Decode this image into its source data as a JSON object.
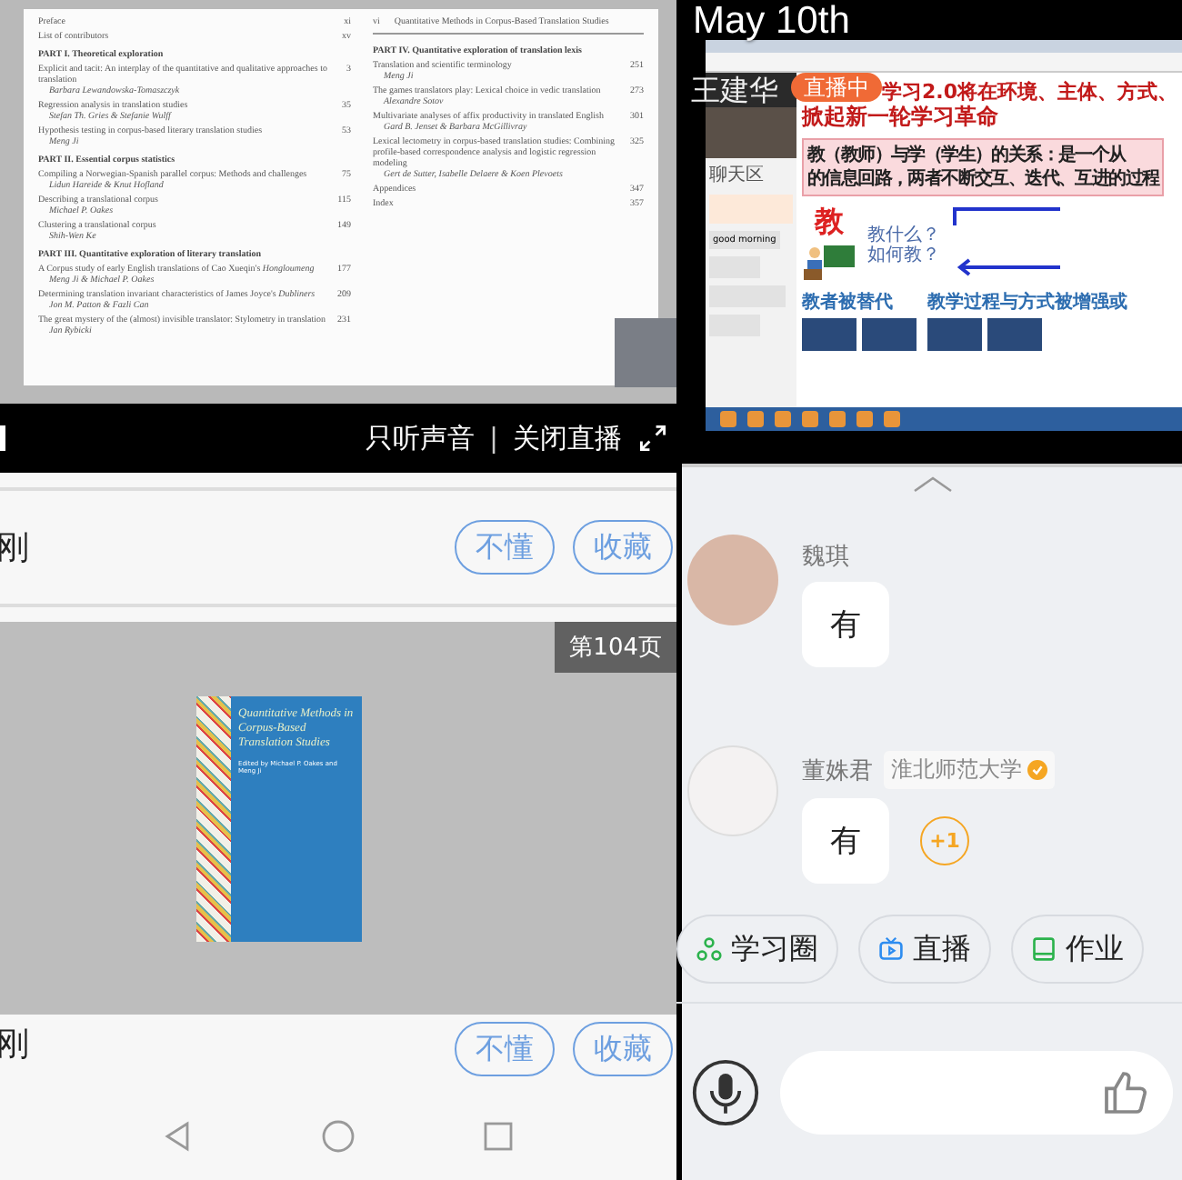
{
  "left_screen": {
    "document": {
      "left_page": [
        {
          "kind": "entry",
          "title": "Preface",
          "page": "xi"
        },
        {
          "kind": "entry",
          "title": "List of contributors",
          "page": "xv"
        },
        {
          "kind": "part",
          "title": "PART I. Theoretical exploration"
        },
        {
          "kind": "entry",
          "title": "Explicit and tacit: An interplay of the quantitative and qualitative approaches to translation",
          "author": "Barbara Lewandowska-Tomaszczyk",
          "page": "3"
        },
        {
          "kind": "entry",
          "title": "Regression analysis in translation studies",
          "author": "Stefan Th. Gries & Stefanie Wulff",
          "page": "35"
        },
        {
          "kind": "entry",
          "title": "Hypothesis testing in corpus-based literary translation studies",
          "author": "Meng Ji",
          "page": "53"
        },
        {
          "kind": "part",
          "title": "PART II. Essential corpus statistics"
        },
        {
          "kind": "entry",
          "title": "Compiling a Norwegian-Spanish parallel corpus: Methods and challenges",
          "author": "Lidun Hareide & Knut Hofland",
          "page": "75"
        },
        {
          "kind": "entry",
          "title": "Describing a translational corpus",
          "author": "Michael P. Oakes",
          "page": "115"
        },
        {
          "kind": "entry",
          "title": "Clustering a translational corpus",
          "author": "Shih-Wen Ke",
          "page": "149"
        },
        {
          "kind": "part",
          "title": "PART III. Quantitative exploration of literary translation"
        },
        {
          "kind": "entry",
          "title": "A Corpus study of early English translations of Cao Xueqin's *Hongloumeng*",
          "author": "Meng Ji & Michael P. Oakes",
          "page": "177"
        },
        {
          "kind": "entry",
          "title": "Determining translation invariant characteristics of James Joyce's *Dubliners*",
          "author": "Jon M. Patton & Fazli Can",
          "page": "209"
        },
        {
          "kind": "entry",
          "title": "The great mystery of the (almost) invisible translator: Stylometry in translation",
          "author": "Jan Rybicki",
          "page": "231"
        }
      ],
      "right_page_header": {
        "page": "vi",
        "title": "Quantitative Methods in Corpus-Based Translation Studies"
      },
      "right_page": [
        {
          "kind": "part",
          "title": "PART IV. Quantitative exploration of translation lexis"
        },
        {
          "kind": "entry",
          "title": "Translation and scientific terminology",
          "author": "Meng Ji",
          "page": "251"
        },
        {
          "kind": "entry",
          "title": "The games translators play: Lexical choice in vedic translation",
          "author": "Alexandre Sotov",
          "page": "273"
        },
        {
          "kind": "entry",
          "title": "Multivariate analyses of affix productivity in translated English",
          "author": "Gard B. Jenset & Barbara McGillivray",
          "page": "301"
        },
        {
          "kind": "entry",
          "title": "Lexical lectometry in corpus-based translation studies: Combining profile-based correspondence analysis and logistic regression modeling",
          "author": "Gert de Sutter, Isabelle Delaere & Koen Plevoets",
          "page": "325"
        },
        {
          "kind": "entry",
          "title": "Appendices",
          "page": "347"
        },
        {
          "kind": "entry",
          "title": "Index",
          "page": "357"
        }
      ]
    },
    "live_controls": {
      "audio_only": "只听声音",
      "separator": "|",
      "close_live": "关闭直播"
    },
    "feed": [
      {
        "kind": "actions",
        "time": "刚",
        "buttons": [
          "不懂",
          "收藏"
        ]
      },
      {
        "kind": "image",
        "page_badge": "第104页",
        "cover_title": "Quantitative Methods in Corpus-Based Translation Studies",
        "cover_editors": "Edited by Michael P. Oakes and Meng Ji"
      },
      {
        "kind": "actions",
        "time": "刚",
        "buttons": [
          "不懂",
          "收藏"
        ]
      }
    ]
  },
  "right_screen": {
    "live_video": {
      "date_overlay": "May 10th",
      "host_name": "王建华",
      "live_badge": "直播中",
      "chat_panel": {
        "title": "聊天区",
        "messages": [
          "good morning"
        ]
      },
      "slide": {
        "title_lines": [
          "学习2.0将在环境、主体、方式、",
          "掀起新一轮学习革命"
        ],
        "callout_lines": [
          "教（教师）与学（学生）的关系：是一个从",
          "的信息回路，两者不断交互、迭代、互进的过程"
        ],
        "teach_label": "教",
        "questions": [
          "教什么？",
          "如何教？"
        ],
        "left_caption": "教者被替代",
        "right_caption": "教学过程与方式被增强或"
      }
    },
    "chat": {
      "messages": [
        {
          "name": "魏琪",
          "text": "有"
        },
        {
          "name": "董姝君",
          "school": "淮北师范大学",
          "verified": true,
          "text": "有",
          "plus_one": "+1"
        }
      ]
    },
    "shortcuts": [
      "学习圈",
      "直播",
      "作业"
    ]
  }
}
